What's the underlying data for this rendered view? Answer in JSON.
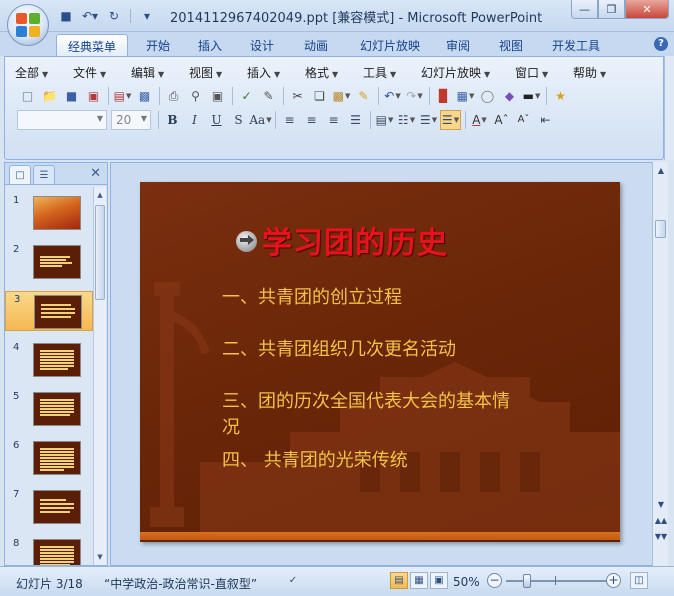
{
  "window": {
    "title": "2014112967402049.ppt [兼容模式] - Microsoft PowerPoint",
    "controls": [
      "minimize-icon",
      "restore-icon",
      "close-icon"
    ]
  },
  "quick_access": [
    "save-icon",
    "undo-icon",
    "redo-icon",
    "customize-icon"
  ],
  "ribbon_tabs": [
    "经典菜单",
    "开始",
    "插入",
    "设计",
    "动画",
    "幻灯片放映",
    "审阅",
    "视图",
    "开发工具"
  ],
  "active_tab": "经典菜单",
  "classic_menu": [
    "全部",
    "文件",
    "编辑",
    "视图",
    "插入",
    "格式",
    "工具",
    "幻灯片放映",
    "窗口",
    "帮助"
  ],
  "font_size_value": "20",
  "font_name_value": "",
  "thumbnails": [
    {
      "num": "1"
    },
    {
      "num": "2"
    },
    {
      "num": "3"
    },
    {
      "num": "4"
    },
    {
      "num": "5"
    },
    {
      "num": "6"
    },
    {
      "num": "7"
    },
    {
      "num": "8"
    }
  ],
  "selected_slide": 3,
  "slide": {
    "title": "学习团的历史",
    "items": [
      "一、共青团的创立过程",
      "二、共青团组织几次更名活动",
      "三、团的历次全国代表大会的基本情况",
      "四、 共青团的光荣传统"
    ]
  },
  "status": {
    "slide_indicator": "幻灯片 3/18",
    "theme": "“中学政治-政治常识-直叙型”",
    "zoom": "50%"
  },
  "colors": {
    "slide_bg": "#6b2608",
    "title": "#e8111c",
    "body_text": "#f2c347",
    "accent_bar": "#d9701d",
    "ribbon": "#dbe7f6"
  }
}
